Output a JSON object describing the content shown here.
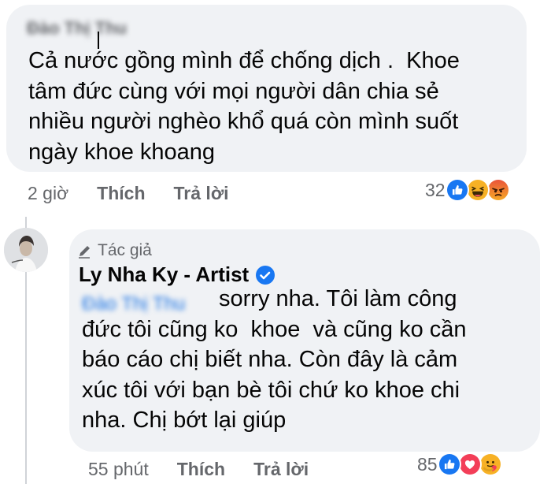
{
  "comment1": {
    "author_blurred": "Đào Thị Thu",
    "lines": [
      "Cả nước gồng mình để chống dịch .  Khoe",
      "tâm đức cùng với mọi người dân chia sẻ",
      "nhiều người nghèo khổ quá còn mình suốt",
      "ngày khoe khoang"
    ],
    "time": "2 giờ",
    "like_label": "Thích",
    "reply_label": "Trả lời",
    "reaction_count": "32",
    "reactions": [
      "like-icon",
      "haha-icon",
      "angry-icon"
    ]
  },
  "reply1": {
    "author_badge": "Tác giả",
    "author_name": "Ly Nha Ky - Artist",
    "mention_blurred": "Đào Thị Thu",
    "first_line_rest": "sorry nha. Tôi làm công",
    "lines": [
      "đức tôi cũng ko  khoe  và cũng ko cần",
      "báo cáo chị biết nha. Còn đây là cảm",
      "xúc tôi với bạn bè tôi chứ ko khoe chi",
      "nha. Chị bớt lại giúp"
    ],
    "time": "55 phút",
    "like_label": "Thích",
    "reply_label": "Trả lời",
    "reaction_count": "85",
    "reactions": [
      "like-icon",
      "love-icon",
      "care-icon"
    ]
  },
  "colors": {
    "bubble": "#f0f2f5",
    "meta_text": "#65676b",
    "like_blue": "#1877f2",
    "verified_blue": "#1877f2"
  }
}
